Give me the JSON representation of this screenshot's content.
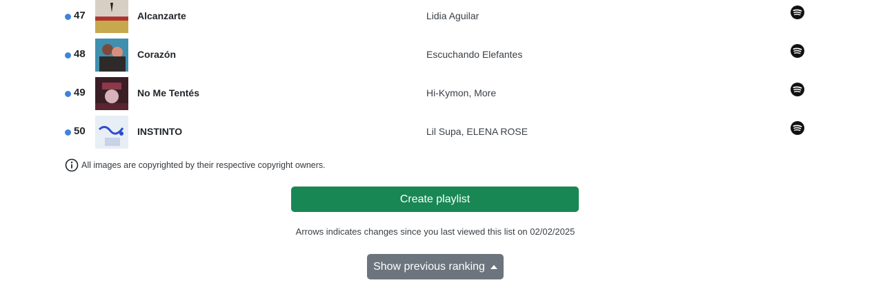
{
  "tracks": [
    {
      "rank": "47",
      "title": "Alcanzarte",
      "artist": "Lidia Aguilar",
      "cover_colors": [
        "#c7a84e",
        "#d8cfc4",
        "#e3d27a"
      ]
    },
    {
      "rank": "48",
      "title": "Corazón",
      "artist": "Escuchando Elefantes",
      "cover_colors": [
        "#3f8fae",
        "#7c4a3a",
        "#d88f7b"
      ]
    },
    {
      "rank": "49",
      "title": "No Me Tentés",
      "artist": "Hi-Kymon, More",
      "cover_colors": [
        "#3a1e26",
        "#8c3a4a",
        "#d7b2b8"
      ]
    },
    {
      "rank": "50",
      "title": "INSTINTO",
      "artist": "Lil Supa, ELENA ROSE",
      "cover_colors": [
        "#e8eef5",
        "#2b4ccf",
        "#c7d3e6"
      ]
    }
  ],
  "rank_dot_color": "#3d85d8",
  "spotify_icon": "spotify-icon",
  "copyright_notice": "All images are copyrighted by their respective copyright owners.",
  "create_playlist_label": "Create playlist",
  "changes_text": "Arrows indicates changes since you last viewed this list on 02/02/2025",
  "show_previous_label": "Show previous ranking",
  "colors": {
    "create_button": "#198754",
    "previous_button": "#6c757d"
  }
}
